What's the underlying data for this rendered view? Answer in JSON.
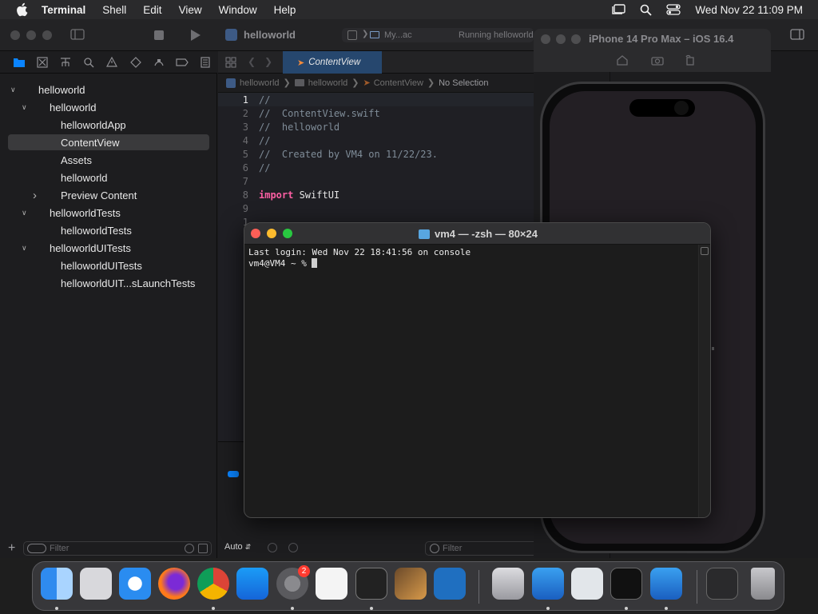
{
  "menubar": {
    "app_name": "Terminal",
    "items": [
      "Shell",
      "Edit",
      "View",
      "Window",
      "Help"
    ],
    "clock": "Wed Nov 22  11:09 PM"
  },
  "xcode": {
    "tab_title": "helloworld",
    "scheme": "My...ac",
    "status": "Running helloworld",
    "editor_tab": "ContentView",
    "breadcrumb": [
      "helloworld",
      "helloworld",
      "ContentView",
      "No Selection"
    ],
    "navigator": [
      {
        "label": "helloworld",
        "depth": 0,
        "disclosure": "open"
      },
      {
        "label": "helloworld",
        "depth": 1,
        "disclosure": "open"
      },
      {
        "label": "helloworldApp",
        "depth": 2,
        "disclosure": ""
      },
      {
        "label": "ContentView",
        "depth": 2,
        "disclosure": "",
        "selected": true
      },
      {
        "label": "Assets",
        "depth": 2,
        "disclosure": ""
      },
      {
        "label": "helloworld",
        "depth": 2,
        "disclosure": ""
      },
      {
        "label": "Preview Content",
        "depth": 2,
        "disclosure": "closed"
      },
      {
        "label": "helloworldTests",
        "depth": 1,
        "disclosure": "open"
      },
      {
        "label": "helloworldTests",
        "depth": 2,
        "disclosure": ""
      },
      {
        "label": "helloworldUITests",
        "depth": 1,
        "disclosure": "open"
      },
      {
        "label": "helloworldUITests",
        "depth": 2,
        "disclosure": ""
      },
      {
        "label": "helloworldUIT...sLaunchTests",
        "depth": 2,
        "disclosure": ""
      }
    ],
    "filter_placeholder": "Filter",
    "code_lines": [
      {
        "n": "1",
        "text": "//"
      },
      {
        "n": "2",
        "text": "//  ContentView.swift"
      },
      {
        "n": "3",
        "text": "//  helloworld"
      },
      {
        "n": "4",
        "text": "//"
      },
      {
        "n": "5",
        "text": "//  Created by VM4 on 11/22/23."
      },
      {
        "n": "6",
        "text": "//"
      },
      {
        "n": "7",
        "text": ""
      },
      {
        "n": "8",
        "keyword": "import",
        "text": " SwiftUI"
      },
      {
        "n": "9",
        "text": ""
      },
      {
        "n": "1",
        "text": ""
      },
      {
        "n": "1",
        "text": ""
      }
    ],
    "bottom_auto": "Auto",
    "debug_filter_placeholder": "Filter"
  },
  "simulator": {
    "title": "iPhone 14 Pro Max – iOS 16.4"
  },
  "terminal": {
    "title": "vm4 — -zsh — 80×24",
    "last_login": "Last login: Wed Nov 22 18:41:56 on console",
    "prompt": "vm4@VM4 ~ % "
  },
  "dock": {
    "apps": [
      "Finder",
      "Launchpad",
      "Safari",
      "Firefox",
      "Chrome",
      "App Store",
      "System Settings",
      "TextEdit",
      "Terminal",
      "GarageBand",
      "Visual Studio Code",
      "Downloads",
      "Xcode",
      "Preview",
      "Activity Monitor",
      "Simulator",
      "Screenshots",
      "Trash"
    ],
    "settings_badge": "2"
  },
  "colors": {
    "accent": "#0a84ff",
    "close": "#ff5f57",
    "minimize": "#febc2e",
    "zoom": "#28c840"
  }
}
